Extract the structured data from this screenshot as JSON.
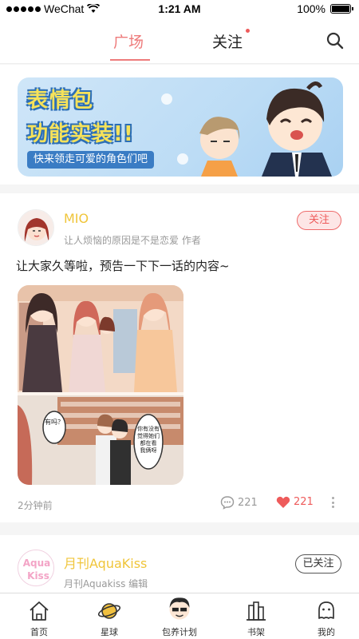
{
  "status_bar": {
    "carrier": "WeChat",
    "time": "1:21 AM",
    "battery": "100%"
  },
  "top_nav": {
    "tabs": [
      {
        "label": "广场",
        "active": true
      },
      {
        "label": "关注",
        "active": false,
        "has_badge": true
      }
    ],
    "accent_color": "#ee7b7b"
  },
  "banner": {
    "line1": "表情包",
    "line2": "功能实装!!",
    "line3": "快来领走可爱的角色们吧"
  },
  "posts": [
    {
      "author": "MIO",
      "author_desc": "让人烦恼的原因是不是恋爱 作者",
      "follow_label": "关注",
      "text": "让大家久等啦，预告一下下一话的内容~",
      "comic_bubbles": [
        "有吗？",
        "你有没有觉得她们都在看我俩呀"
      ],
      "time": "2分钟前",
      "comments": "221",
      "likes": "221"
    },
    {
      "author": "月刊AquaKiss",
      "author_desc": "月刊Aquakiss 编辑",
      "follow_label": "已关注",
      "avatar_text_top": "Aqua",
      "avatar_text_bottom": "Kiss"
    }
  ],
  "bottom_nav": {
    "items": [
      {
        "label": "首页",
        "icon": "home-icon"
      },
      {
        "label": "星球",
        "icon": "planet-icon"
      },
      {
        "label": "包养计划",
        "icon": "character-icon"
      },
      {
        "label": "书架",
        "icon": "bookshelf-icon"
      },
      {
        "label": "我的",
        "icon": "profile-icon"
      }
    ]
  }
}
